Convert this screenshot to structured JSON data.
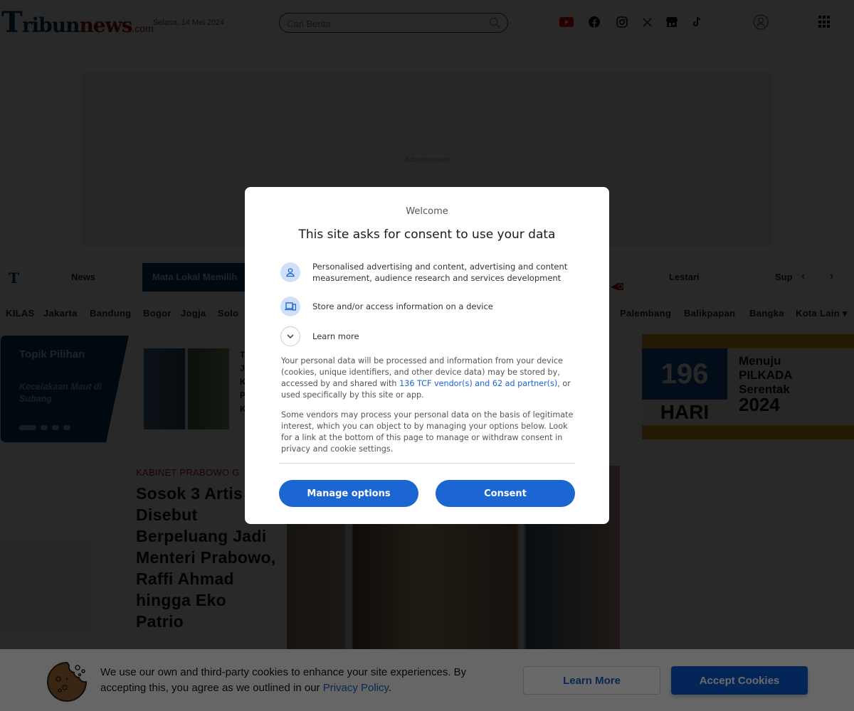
{
  "header": {
    "logo": {
      "part1": "T",
      "part2": "ribun",
      "part3": "news",
      "part4": ".com"
    },
    "date": "Selasa, 14 Mei 2024",
    "search": {
      "placeholder": "Cari Berita",
      "value": ""
    },
    "social_icons": [
      "youtube-icon",
      "facebook-icon",
      "instagram-icon",
      "x-icon",
      "store-icon",
      "tiktok-icon"
    ],
    "colors": {
      "brand_blue": "#0b3a66",
      "brand_red": "#9a1010"
    }
  },
  "ad": {
    "label": "Advertisement"
  },
  "nav_primary": {
    "items": [
      {
        "label": "News",
        "active": false
      },
      {
        "label": "Mata Lokal Memilih",
        "active": true
      },
      {
        "label": "Lestari",
        "active": false
      },
      {
        "label": "Sup",
        "active": false
      }
    ]
  },
  "nav_cities": {
    "items": [
      "KILAS",
      "Jakarta",
      "Bandung",
      "Bogor",
      "Jogja",
      "Solo",
      "Palembang",
      "Balikpapan",
      "Bangka",
      "Kota Lain"
    ]
  },
  "topik": {
    "title": "Topik Pilihan",
    "subtitle": "Kecelakaan Maut di Subang",
    "text_lines": [
      "T",
      "J",
      "K",
      "P",
      "K"
    ],
    "slides": 4,
    "active_slide": 1
  },
  "pilkada_banner": {
    "days": "196",
    "days_label": "HARI",
    "line1": "Menuju",
    "line2": "PILKADA",
    "line3": "Serentak",
    "year": "2024"
  },
  "article": {
    "kicker": "KABINET PRABOWO G",
    "headline": "Sosok 3 Artis Disebut Berpeluang Jadi Menteri Prabowo, Raffi Ahmad hingga Eko Patrio"
  },
  "consent_modal": {
    "welcome": "Welcome",
    "title": "This site asks for consent to use your data",
    "purposes": [
      {
        "icon": "person-icon",
        "text": "Personalised advertising and content, advertising and content measurement, audience research and services development"
      },
      {
        "icon": "device-icon",
        "text": "Store and/or access information on a device"
      },
      {
        "icon": "chevron-down-icon",
        "text": "Learn more"
      }
    ],
    "para1_before": "Your personal data will be processed and information from your device (cookies, unique identifiers, and other device data) may be stored by, accessed by and shared with ",
    "para1_link": "136 TCF vendor(s) and 62 ad partner(s)",
    "para1_after": ", or used specifically by this site or app.",
    "para2": "Some vendors may process your personal data on the basis of legitimate interest, which you can object to by managing your options below. Look for a link at the bottom of this page to manage or withdraw consent in privacy and cookie settings.",
    "manage_label": "Manage options",
    "consent_label": "Consent",
    "accent": "#1b66d2"
  },
  "cookie_banner": {
    "text_before": "We use our own and third-party cookies to enhance your site experiences. By accepting this, you agree as we outlined in our ",
    "link": "Privacy Policy",
    "text_after": ".",
    "learn_more": "Learn More",
    "accept": "Accept Cookies"
  }
}
